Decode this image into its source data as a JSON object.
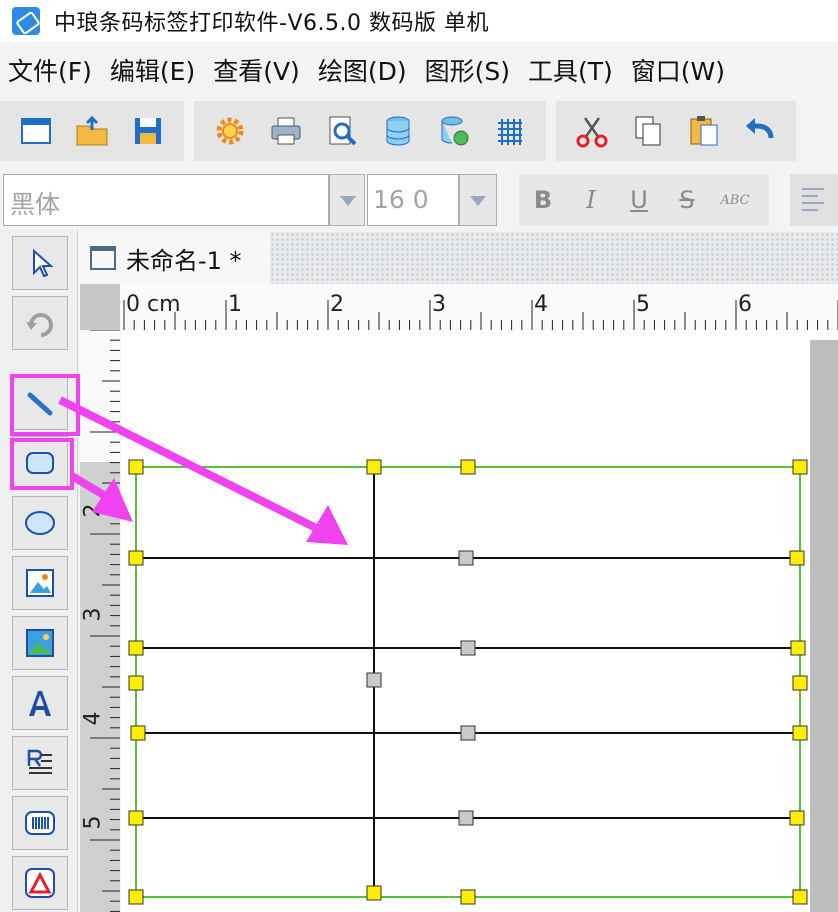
{
  "titlebar": {
    "title": "中琅条码标签打印软件-V6.5.0 数码版 单机"
  },
  "menu": [
    "文件(F)",
    "编辑(E)",
    "查看(V)",
    "绘图(D)",
    "图形(S)",
    "工具(T)",
    "窗口(W)"
  ],
  "toolbar": {
    "groups": [
      [
        "new-window-icon",
        "open-folder-icon",
        "save-disk-icon"
      ],
      [
        "gear-settings-icon",
        "printer-icon",
        "print-preview-icon",
        "database-icon",
        "database-settings-icon",
        "grid-icon"
      ],
      [
        "scissors-icon",
        "copy-icon",
        "paste-icon",
        "undo-icon"
      ]
    ]
  },
  "fontbar": {
    "font_family": "黑体",
    "font_size": "16 0",
    "format_buttons": [
      "B",
      "I",
      "U",
      "S",
      "ABC"
    ]
  },
  "document": {
    "tab_title": "未命名-1 *"
  },
  "ruler": {
    "h_labels": [
      "0 cm",
      "1",
      "2",
      "3",
      "4",
      "5",
      "6"
    ],
    "v_labels": [
      "2",
      "3",
      "4",
      "5"
    ]
  },
  "tools": [
    "select-arrow-icon",
    "rotate-icon",
    "line-tool-icon",
    "rectangle-tool-icon",
    "ellipse-tool-icon",
    "image-tool-icon",
    "picture-tool-icon",
    "text-tool-icon",
    "rich-text-tool-icon",
    "barcode-tool-icon",
    "shape-tool-icon"
  ],
  "colors": {
    "highlight": "#f043f0",
    "frame": "#55c23a",
    "handle": "#ffee00",
    "handle_gray": "#c9c9c9"
  }
}
